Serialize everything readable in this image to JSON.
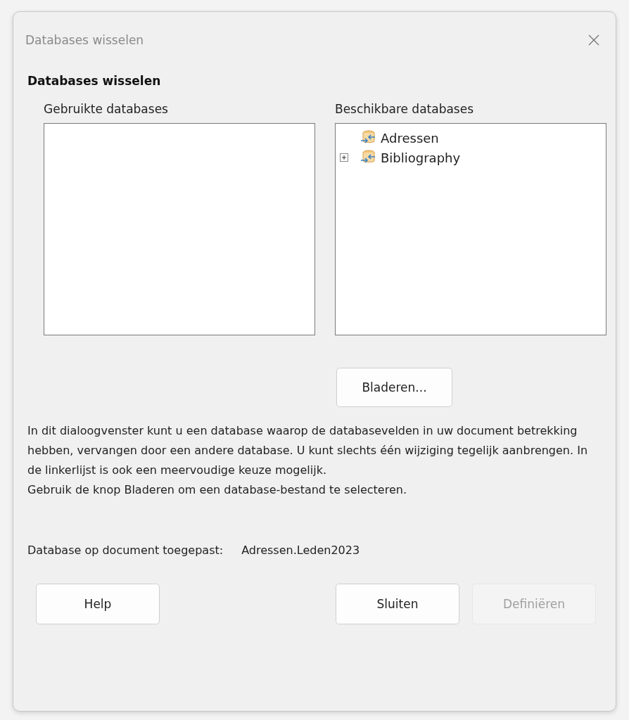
{
  "window": {
    "title": "Databases wisselen"
  },
  "heading": "Databases wisselen",
  "used_databases": {
    "label": "Gebruikte databases"
  },
  "available_databases": {
    "label": "Beschikbare databases",
    "items": [
      {
        "label": "Adressen",
        "kind": "leaf"
      },
      {
        "label": "Bibliography",
        "kind": "expandable"
      }
    ]
  },
  "browse_button": "Bladeren...",
  "description": [
    "In dit dialoogvenster kunt u een database waarop de databasevelden in uw document betrekking hebben, vervangen door een andere database. U kunt slechts één wijziging tegelijk aanbrengen. In de linkerlijst is ook een meervoudige keuze mogelijk.",
    "Gebruik de knop Bladeren om een database-bestand te selecteren."
  ],
  "applied": {
    "label": "Database op document toegepast:",
    "value": "Adressen.Leden2023"
  },
  "buttons": [
    {
      "label": "Help",
      "disabled": false
    },
    {
      "label": "Sluiten",
      "disabled": false
    },
    {
      "label": "Definiëren",
      "disabled": true
    }
  ]
}
